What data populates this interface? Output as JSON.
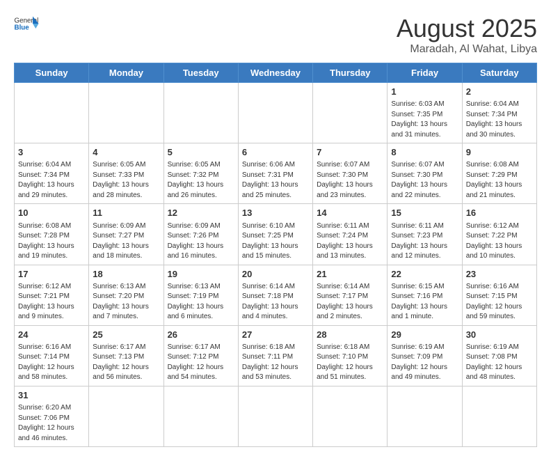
{
  "header": {
    "logo_general": "General",
    "logo_blue": "Blue",
    "title": "August 2025",
    "subtitle": "Maradah, Al Wahat, Libya"
  },
  "weekdays": [
    "Sunday",
    "Monday",
    "Tuesday",
    "Wednesday",
    "Thursday",
    "Friday",
    "Saturday"
  ],
  "weeks": [
    [
      {
        "day": null
      },
      {
        "day": null
      },
      {
        "day": null
      },
      {
        "day": null
      },
      {
        "day": null
      },
      {
        "day": 1,
        "sunrise": "6:03 AM",
        "sunset": "7:35 PM",
        "daylight": "13 hours and 31 minutes."
      },
      {
        "day": 2,
        "sunrise": "6:04 AM",
        "sunset": "7:34 PM",
        "daylight": "13 hours and 30 minutes."
      }
    ],
    [
      {
        "day": 3,
        "sunrise": "6:04 AM",
        "sunset": "7:34 PM",
        "daylight": "13 hours and 29 minutes."
      },
      {
        "day": 4,
        "sunrise": "6:05 AM",
        "sunset": "7:33 PM",
        "daylight": "13 hours and 28 minutes."
      },
      {
        "day": 5,
        "sunrise": "6:05 AM",
        "sunset": "7:32 PM",
        "daylight": "13 hours and 26 minutes."
      },
      {
        "day": 6,
        "sunrise": "6:06 AM",
        "sunset": "7:31 PM",
        "daylight": "13 hours and 25 minutes."
      },
      {
        "day": 7,
        "sunrise": "6:07 AM",
        "sunset": "7:30 PM",
        "daylight": "13 hours and 23 minutes."
      },
      {
        "day": 8,
        "sunrise": "6:07 AM",
        "sunset": "7:30 PM",
        "daylight": "13 hours and 22 minutes."
      },
      {
        "day": 9,
        "sunrise": "6:08 AM",
        "sunset": "7:29 PM",
        "daylight": "13 hours and 21 minutes."
      }
    ],
    [
      {
        "day": 10,
        "sunrise": "6:08 AM",
        "sunset": "7:28 PM",
        "daylight": "13 hours and 19 minutes."
      },
      {
        "day": 11,
        "sunrise": "6:09 AM",
        "sunset": "7:27 PM",
        "daylight": "13 hours and 18 minutes."
      },
      {
        "day": 12,
        "sunrise": "6:09 AM",
        "sunset": "7:26 PM",
        "daylight": "13 hours and 16 minutes."
      },
      {
        "day": 13,
        "sunrise": "6:10 AM",
        "sunset": "7:25 PM",
        "daylight": "13 hours and 15 minutes."
      },
      {
        "day": 14,
        "sunrise": "6:11 AM",
        "sunset": "7:24 PM",
        "daylight": "13 hours and 13 minutes."
      },
      {
        "day": 15,
        "sunrise": "6:11 AM",
        "sunset": "7:23 PM",
        "daylight": "13 hours and 12 minutes."
      },
      {
        "day": 16,
        "sunrise": "6:12 AM",
        "sunset": "7:22 PM",
        "daylight": "13 hours and 10 minutes."
      }
    ],
    [
      {
        "day": 17,
        "sunrise": "6:12 AM",
        "sunset": "7:21 PM",
        "daylight": "13 hours and 9 minutes."
      },
      {
        "day": 18,
        "sunrise": "6:13 AM",
        "sunset": "7:20 PM",
        "daylight": "13 hours and 7 minutes."
      },
      {
        "day": 19,
        "sunrise": "6:13 AM",
        "sunset": "7:19 PM",
        "daylight": "13 hours and 6 minutes."
      },
      {
        "day": 20,
        "sunrise": "6:14 AM",
        "sunset": "7:18 PM",
        "daylight": "13 hours and 4 minutes."
      },
      {
        "day": 21,
        "sunrise": "6:14 AM",
        "sunset": "7:17 PM",
        "daylight": "13 hours and 2 minutes."
      },
      {
        "day": 22,
        "sunrise": "6:15 AM",
        "sunset": "7:16 PM",
        "daylight": "13 hours and 1 minute."
      },
      {
        "day": 23,
        "sunrise": "6:16 AM",
        "sunset": "7:15 PM",
        "daylight": "12 hours and 59 minutes."
      }
    ],
    [
      {
        "day": 24,
        "sunrise": "6:16 AM",
        "sunset": "7:14 PM",
        "daylight": "12 hours and 58 minutes."
      },
      {
        "day": 25,
        "sunrise": "6:17 AM",
        "sunset": "7:13 PM",
        "daylight": "12 hours and 56 minutes."
      },
      {
        "day": 26,
        "sunrise": "6:17 AM",
        "sunset": "7:12 PM",
        "daylight": "12 hours and 54 minutes."
      },
      {
        "day": 27,
        "sunrise": "6:18 AM",
        "sunset": "7:11 PM",
        "daylight": "12 hours and 53 minutes."
      },
      {
        "day": 28,
        "sunrise": "6:18 AM",
        "sunset": "7:10 PM",
        "daylight": "12 hours and 51 minutes."
      },
      {
        "day": 29,
        "sunrise": "6:19 AM",
        "sunset": "7:09 PM",
        "daylight": "12 hours and 49 minutes."
      },
      {
        "day": 30,
        "sunrise": "6:19 AM",
        "sunset": "7:08 PM",
        "daylight": "12 hours and 48 minutes."
      }
    ],
    [
      {
        "day": 31,
        "sunrise": "6:20 AM",
        "sunset": "7:06 PM",
        "daylight": "12 hours and 46 minutes."
      },
      {
        "day": null
      },
      {
        "day": null
      },
      {
        "day": null
      },
      {
        "day": null
      },
      {
        "day": null
      },
      {
        "day": null
      }
    ]
  ]
}
